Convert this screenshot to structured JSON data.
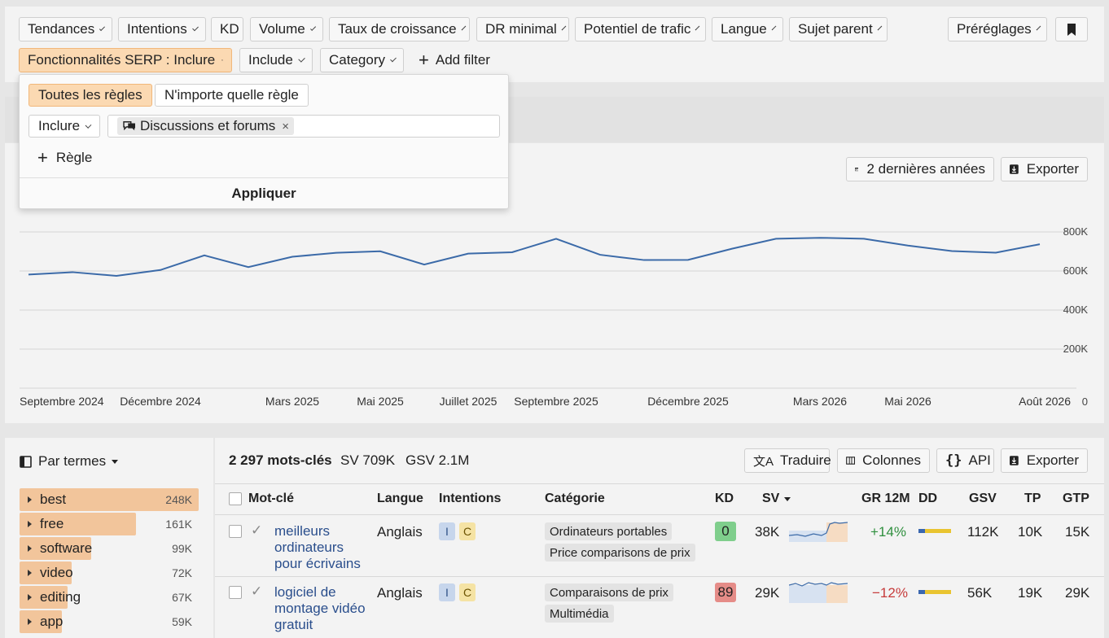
{
  "filters_row1": [
    {
      "label": "Tendances",
      "chev": true
    },
    {
      "label": "Intentions",
      "chev": true
    },
    {
      "label": "KD",
      "chev": false
    },
    {
      "label": "Volume",
      "chev": true
    },
    {
      "label": "Taux de croissance",
      "chev": true
    },
    {
      "label": "DR minimal",
      "chev": true
    },
    {
      "label": "Potentiel de trafic",
      "chev": true
    },
    {
      "label": "Langue",
      "chev": true
    },
    {
      "label": "Sujet parent",
      "chev": true
    }
  ],
  "presets_label": "Préréglages",
  "filters_row2": {
    "serp_label": "Fonctionnalités SERP : Inclure",
    "include_label": "Include",
    "category_label": "Category",
    "add_filter_label": "Add filter"
  },
  "dropdown": {
    "all_rules": "Toutes les règles",
    "any_rule": "N'importe quelle règle",
    "include_select": "Inclure",
    "token": "Discussions et forums",
    "add_rule": "Règle",
    "apply": "Appliquer"
  },
  "chart_controls": {
    "period": "2 dernières années",
    "export": "Exporter"
  },
  "chart_data": {
    "type": "line",
    "x": [
      "Sep 2024",
      "Oct 2024",
      "Nov 2024",
      "Dec 2024",
      "Jan 2025",
      "Feb 2025",
      "Mar 2025",
      "Apr 2025",
      "May 2025",
      "Jun 2025",
      "Jul 2025",
      "Aug 2025",
      "Sep 2025",
      "Oct 2025",
      "Nov 2025",
      "Dec 2025",
      "Jan 2026",
      "Feb 2026",
      "Mar 2026",
      "Apr 2026",
      "May 2026",
      "Jun 2026",
      "Jul 2026",
      "Aug 2026"
    ],
    "series": [
      {
        "values": [
          582,
          594,
          575,
          605,
          680,
          620,
          673,
          693,
          701,
          633,
          689,
          696,
          765,
          683,
          656,
          657,
          714,
          765,
          770,
          765,
          730,
          702,
          694,
          737
        ]
      }
    ],
    "yticks": [
      "800K",
      "600K",
      "400K",
      "200K",
      "0"
    ],
    "ytick_values": [
      800,
      600,
      400,
      200,
      0
    ],
    "ylim": [
      0,
      1000
    ],
    "xticks": [
      "Septembre 2024",
      "Décembre 2024",
      "Mars 2025",
      "Mai 2025",
      "Juillet 2025",
      "Septembre 2025",
      "Décembre 2025",
      "Mars 2026",
      "Mai 2026",
      "Août 2026"
    ],
    "xtick_index": [
      0,
      3,
      6,
      8,
      10,
      12,
      15,
      18,
      20,
      23
    ],
    "grid": true,
    "color": "#3b6aa8"
  },
  "terms": {
    "header": "Par termes",
    "items": [
      {
        "label": "best",
        "count": "248K",
        "value": 248
      },
      {
        "label": "free",
        "count": "161K",
        "value": 161
      },
      {
        "label": "software",
        "count": "99K",
        "value": 99
      },
      {
        "label": "video",
        "count": "72K",
        "value": 72
      },
      {
        "label": "editing",
        "count": "67K",
        "value": 67
      },
      {
        "label": "app",
        "count": "59K",
        "value": 59
      }
    ]
  },
  "summary": {
    "keywords": "2 297 mots-clés",
    "sv": "SV 709K",
    "gsv": "GSV 2.1M"
  },
  "table_toolbar": {
    "translate": "Traduire",
    "columns": "Colonnes",
    "api": "API",
    "export": "Exporter"
  },
  "columns": {
    "keyword": "Mot-clé",
    "lang": "Langue",
    "intents": "Intentions",
    "category": "Catégorie",
    "kd": "KD",
    "sv": "SV",
    "gr": "GR 12M",
    "dd": "DD",
    "gsv": "GSV",
    "tp": "TP",
    "gtp": "GTP"
  },
  "rows": [
    {
      "kw1": "meilleurs",
      "kw2": "ordinateurs",
      "kw3": "pour écrivains",
      "lang": "Anglais",
      "i": "I",
      "c": "C",
      "cat1": "Ordinateurs portables",
      "cat2": "Price comparisons de prix",
      "kd": "0",
      "kd_color": "#7fce8c",
      "sv": "38K",
      "gr": "+14%",
      "gr_color": "#2f8f3e",
      "gsv": "112K",
      "tp": "10K",
      "gtp": "15K"
    },
    {
      "kw1": "logiciel de",
      "kw2": "montage vidéo",
      "kw3": "gratuit",
      "lang": "Anglais",
      "i": "I",
      "c": "C",
      "cat1": "Comparaisons de prix",
      "cat2": "Multimédia",
      "kd": "89",
      "kd_color": "#e58c88",
      "sv": "29K",
      "gr": "−12%",
      "gr_color": "#c63a3a",
      "gsv": "56K",
      "tp": "19K",
      "gtp": "29K"
    }
  ]
}
